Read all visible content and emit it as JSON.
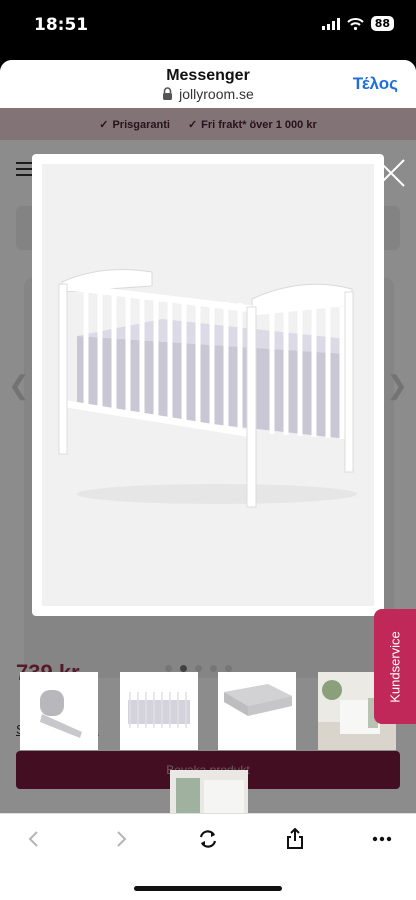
{
  "status": {
    "time": "18:51",
    "battery": "88"
  },
  "browser": {
    "title": "Messenger",
    "url": "jollyroom.se",
    "done_label": "Τέλος"
  },
  "page": {
    "promo": [
      {
        "label": "Prisgaranti"
      },
      {
        "label": "Fri frakt* över 1 000 kr"
      }
    ],
    "price_visible": "739 kr",
    "link_start": "S",
    "link_end": "k",
    "buy_button": "Bevaka produkt"
  },
  "gallery": {
    "images": [
      "crib-bumper",
      "crib",
      "mattress",
      "room-photo",
      "room-photo-2"
    ],
    "current_index": 1
  },
  "side_tab": {
    "label": "Kundservice"
  },
  "colors": {
    "accent": "#7a1a3e",
    "side_tab": "#c0285a",
    "link": "#1e6fd9",
    "promo_bg": "#ecd1d8"
  }
}
